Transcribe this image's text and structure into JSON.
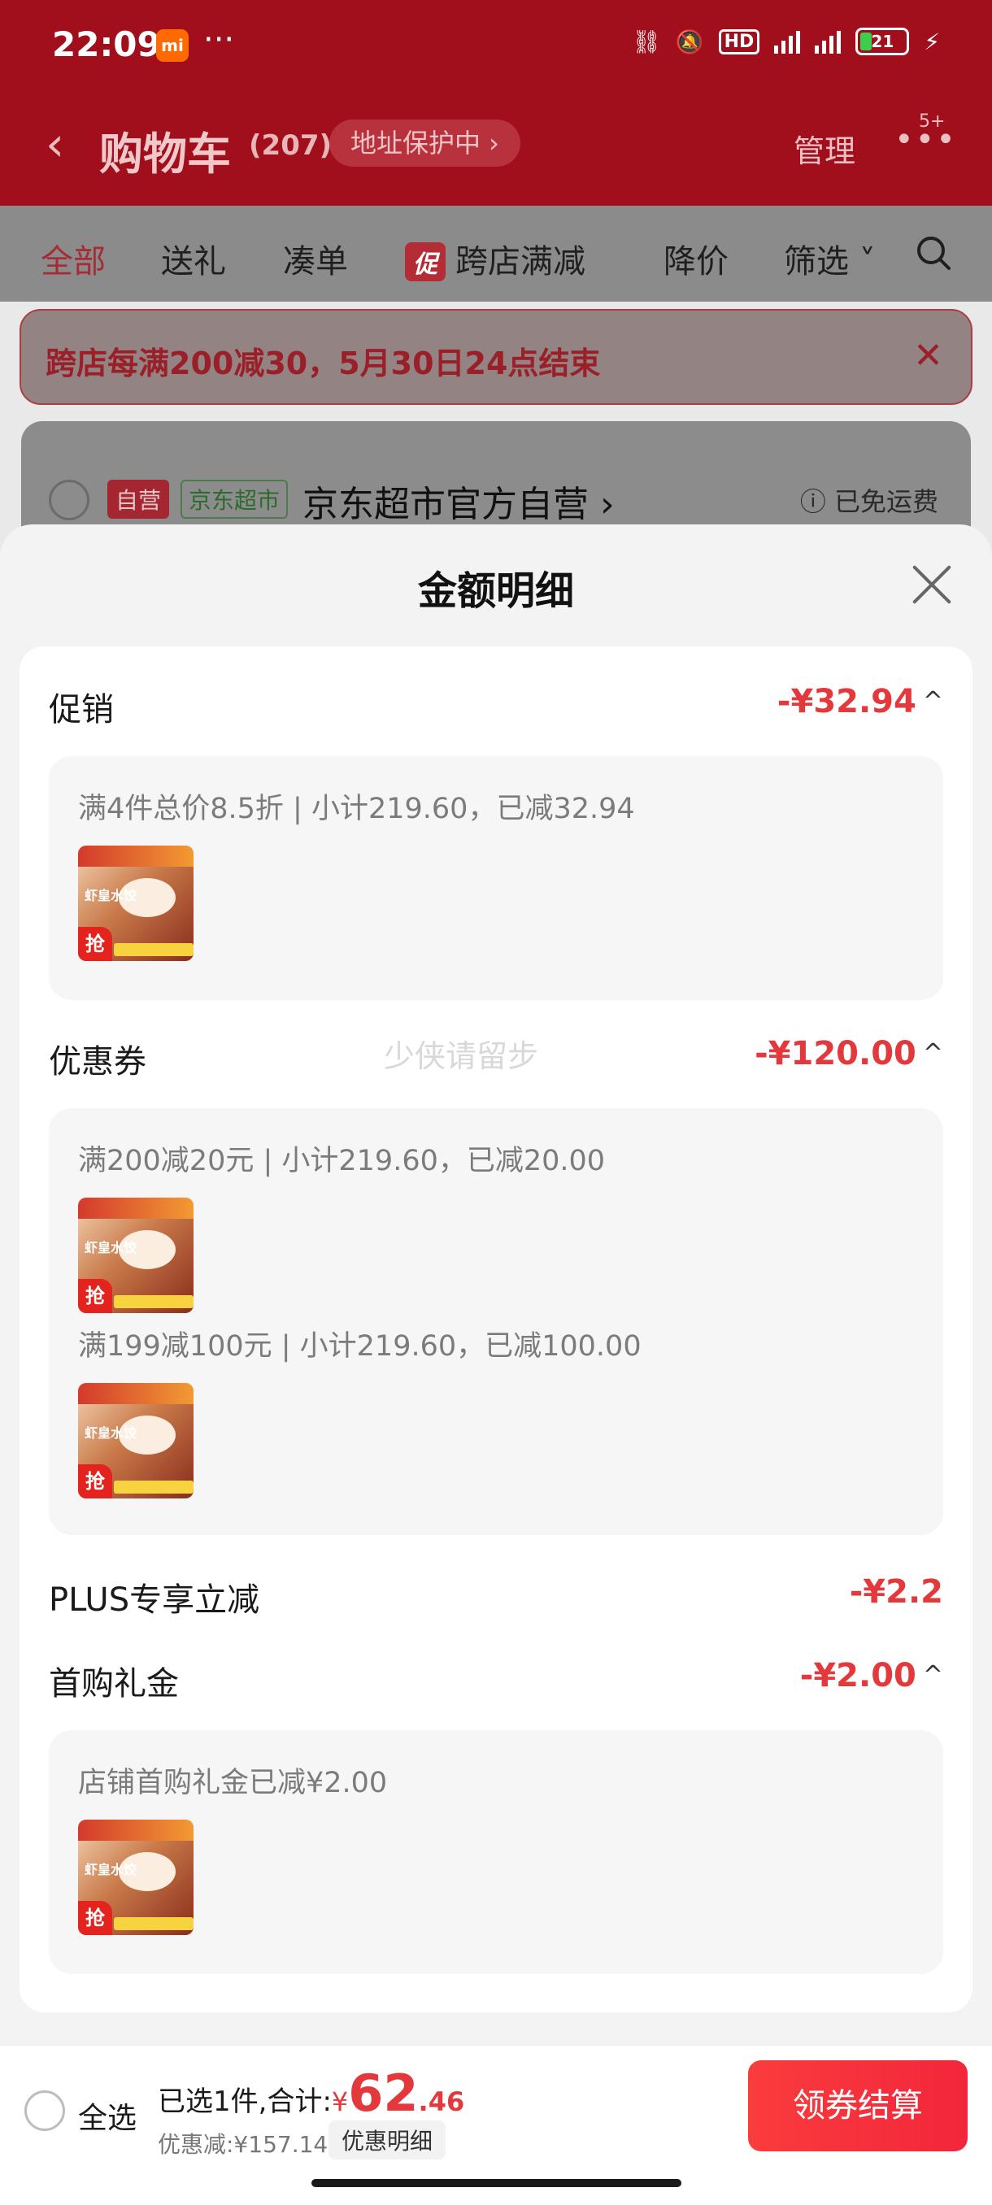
{
  "status_bar": {
    "time": "22:09",
    "mi_label": "mi",
    "dots": "···",
    "battery": "21"
  },
  "nav": {
    "title": "购物车",
    "count": "(207)",
    "address_protection": "地址保护中 ›",
    "manage": "管理",
    "more_badge": "5+"
  },
  "filter_tabs": [
    {
      "label": "全部",
      "active": true
    },
    {
      "label": "送礼"
    },
    {
      "label": "凑单"
    },
    {
      "label": "跨店满减",
      "tag": "促"
    },
    {
      "label": "降价"
    },
    {
      "label": "筛选 ˅"
    }
  ],
  "notice": {
    "text": "跨店每满200减30，5月30日24点结束",
    "close": "✕"
  },
  "store": {
    "self_tag": "自营",
    "jd_tag": "京东超市",
    "name": "京东超市官方自营 ›",
    "shipping": "ⓘ 已免运费"
  },
  "sheet": {
    "title": "金额明细",
    "watermark": "少侠请留步",
    "sections": {
      "promotion": {
        "label": "促销",
        "amount": "-¥32.94",
        "line": "满4件总价8.5折 | 小计219.60，已减32.94"
      },
      "coupon": {
        "label": "优惠券",
        "amount": "-¥120.00",
        "lines": [
          "满200减20元 | 小计219.60，已减20.00",
          "满199减100元 | 小计219.60，已减100.00"
        ]
      },
      "plus": {
        "label": "PLUS专享立减",
        "amount": "-¥2.2"
      },
      "first_purchase": {
        "label": "首购礼金",
        "amount": "-¥2.00",
        "line": "店铺首购礼金已减¥2.00"
      }
    },
    "thumb": {
      "text": "虾皇水饺",
      "badge": "抢"
    }
  },
  "bottom": {
    "select_all": "全选",
    "selected_prefix": "已选1件,合计:",
    "yen": "¥",
    "total_int": "62",
    "total_dec": ".46",
    "discount": "优惠减:¥157.14",
    "detail_button": "优惠明细",
    "checkout": "领券结算"
  },
  "colors": {
    "accent_red": "#e4393c",
    "header_red": "#a10f1c"
  }
}
